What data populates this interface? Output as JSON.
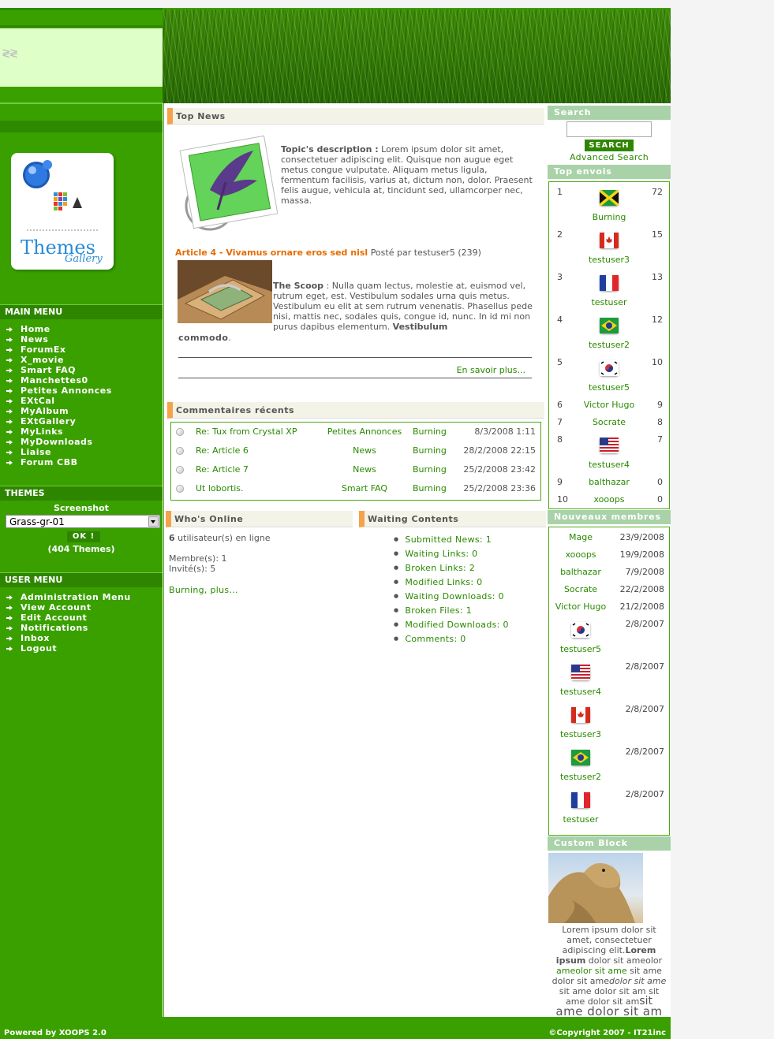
{
  "main_menu": {
    "title": "MAIN MENU",
    "items": [
      "Home",
      "News",
      "ForumEx",
      "X_movie",
      "Smart FAQ",
      "Manchettes0",
      "Petites Annonces",
      "EXtCal",
      "MyAlbum",
      "EXtGallery",
      "MyLinks",
      "MyDownloads",
      "Liaise",
      "Forum CBB"
    ]
  },
  "themes": {
    "title": "THEMES",
    "screenshot_label": "Screenshot",
    "selected": "Grass-gr-01",
    "ok_label": "OK !",
    "count": "(404 Themes)"
  },
  "user_menu": {
    "title": "USER MENU",
    "items": [
      "Administration Menu",
      "View Account",
      "Edit Account",
      "Notifications",
      "Inbox",
      "Logout"
    ]
  },
  "logo": {
    "text": "Themes",
    "script": "Gallery"
  },
  "top_news": {
    "title": "Top News",
    "topic_label": "Topic's description :",
    "topic_text": "Lorem ipsum dolor sit amet, consectetuer adipiscing elit. Quisque non augue eget metus congue vulputate. Aliquam metus ligula, fermentum facilisis, varius at, dictum non, dolor. Praesent felis augue, vehicula at, tincidunt sed, ullamcorper nec, massa.",
    "article_title": "Article 4 - Vivamus ornare eros sed nisl",
    "article_meta": "Posté par testuser5 (239)",
    "scoop_label": "The Scoop",
    "scoop_text": ": Nulla quam lectus, molestie at, euismod vel, rutrum eget, est. Vestibulum sodales urna quis metus. Vestibulum eu elit at sem rutrum venenatis. Phasellus pede nisi, mattis nec, sodales quis, congue id, nunc. In id mi non purus dapibus elementum.",
    "scoop_bold": "Vestibulum",
    "scoop_end": "commodo",
    "read_more": "En savoir plus..."
  },
  "recent_comments": {
    "title": "Commentaires récents",
    "rows": [
      {
        "title": "Re: Tux from Crystal XP",
        "module": "Petites Annonces",
        "user": "Burning",
        "date": "8/3/2008 1:11"
      },
      {
        "title": "Re: Article 6",
        "module": "News",
        "user": "Burning",
        "date": "28/2/2008 22:15"
      },
      {
        "title": "Re: Article 7",
        "module": "News",
        "user": "Burning",
        "date": "25/2/2008 23:42"
      },
      {
        "title": "Ut lobortis.",
        "module": "Smart FAQ",
        "user": "Burning",
        "date": "25/2/2008 23:36"
      }
    ]
  },
  "whos_online": {
    "title": "Who's Online",
    "count": "6",
    "online_text": "utilisateur(s) en ligne",
    "members": "Membre(s): 1",
    "guests": "Invité(s): 5",
    "link": "Burning, plus..."
  },
  "waiting": {
    "title": "Waiting Contents",
    "items": [
      "Submitted News: 1",
      "Waiting Links: 0",
      "Broken Links: 2",
      "Modified Links: 0",
      "Waiting Downloads: 0",
      "Broken Files: 1",
      "Modified Downloads: 0",
      "Comments: 0"
    ]
  },
  "search": {
    "title": "Search",
    "button": "SEARCH",
    "advanced": "Advanced Search"
  },
  "top_posters": {
    "title": "Top envois",
    "rows": [
      {
        "rank": "1",
        "name": "Burning",
        "posts": "72",
        "flag": "jamaica"
      },
      {
        "rank": "2",
        "name": "testuser3",
        "posts": "15",
        "flag": "canada"
      },
      {
        "rank": "3",
        "name": "testuser",
        "posts": "13",
        "flag": "france"
      },
      {
        "rank": "4",
        "name": "testuser2",
        "posts": "12",
        "flag": "brazil"
      },
      {
        "rank": "5",
        "name": "testuser5",
        "posts": "10",
        "flag": "korea"
      },
      {
        "rank": "6",
        "name": "Victor Hugo",
        "posts": "9",
        "flag": ""
      },
      {
        "rank": "7",
        "name": "Socrate",
        "posts": "8",
        "flag": ""
      },
      {
        "rank": "8",
        "name": "testuser4",
        "posts": "7",
        "flag": "usa"
      },
      {
        "rank": "9",
        "name": "balthazar",
        "posts": "0",
        "flag": ""
      },
      {
        "rank": "10",
        "name": "xooops",
        "posts": "0",
        "flag": ""
      }
    ]
  },
  "new_members": {
    "title": "Nouveaux membres",
    "rows": [
      {
        "name": "Mage",
        "date": "23/9/2008",
        "flag": ""
      },
      {
        "name": "xooops",
        "date": "19/9/2008",
        "flag": ""
      },
      {
        "name": "balthazar",
        "date": "7/9/2008",
        "flag": ""
      },
      {
        "name": "Socrate",
        "date": "22/2/2008",
        "flag": ""
      },
      {
        "name": "Victor Hugo",
        "date": "21/2/2008",
        "flag": ""
      },
      {
        "name": "testuser5",
        "date": "2/8/2007",
        "flag": "korea"
      },
      {
        "name": "testuser4",
        "date": "2/8/2007",
        "flag": "usa"
      },
      {
        "name": "testuser3",
        "date": "2/8/2007",
        "flag": "canada"
      },
      {
        "name": "testuser2",
        "date": "2/8/2007",
        "flag": "brazil"
      },
      {
        "name": "testuser",
        "date": "2/8/2007",
        "flag": "france"
      }
    ]
  },
  "custom_block": {
    "title": "Custom Block",
    "t1": "Lorem ipsum dolor sit amet, consectetuer adipiscing elit.",
    "t2": "Lorem ipsum",
    "t3": "dolor sit ameolor",
    "t4": "ameolor sit ame",
    "t5": "sit ame dolor sit ame",
    "t6": "dolor sit ame",
    "t7": "sit ame dolor sit am sit ame dolor sit am",
    "t8": "sit",
    "t9": "ame dolor sit am"
  },
  "footer": {
    "left": "Powered by XOOPS 2.0",
    "right": "©Copyright 2007 - IT21inc"
  },
  "colors": {
    "green": "#3aa000",
    "dark_green": "#2e8600",
    "light_green": "#dfffc8",
    "orange": "#f5a24a",
    "link": "#2a8a00"
  }
}
